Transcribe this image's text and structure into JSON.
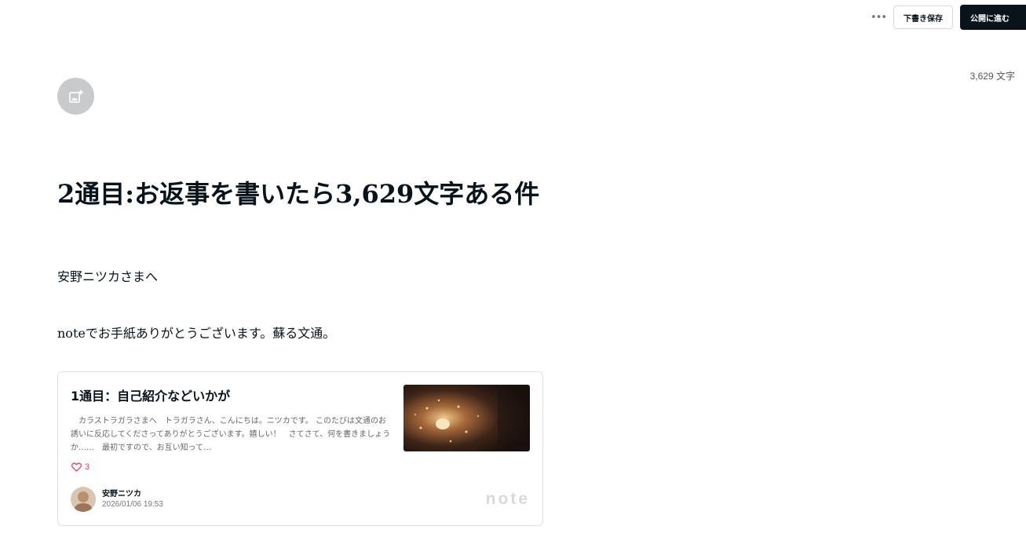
{
  "toolbar": {
    "more_label": "•••",
    "draft_label": "下書き保存",
    "publish_label": "公開に進む"
  },
  "char_count": "3,629 文字",
  "editor": {
    "title": "2通目:お返事を書いたら3,629文字ある件",
    "paragraphs": [
      "安野ニツカさまへ",
      "noteでお手紙ありがとうございます。蘇る文通。"
    ]
  },
  "embed": {
    "title": "1通目：自己紹介などいかが",
    "excerpt": "　カラストラガラさまへ　トラガラさん、こんにちは。ニツカです。 このたびは文通のお誘いに反応してくださってありがとうございます。嬉しい！　さてさて、何を書きましょうか……　最初ですので、お互い知って…",
    "likes": "3",
    "author_name": "安野ニツカ",
    "date": "2026/01/06 19:53",
    "logo": "note"
  },
  "icons": {
    "add_image": "image-add-icon",
    "heart": "heart-icon"
  },
  "colors": {
    "primary": "#08131a",
    "like": "#e2425b",
    "icon_circle": "#c9cacb"
  }
}
